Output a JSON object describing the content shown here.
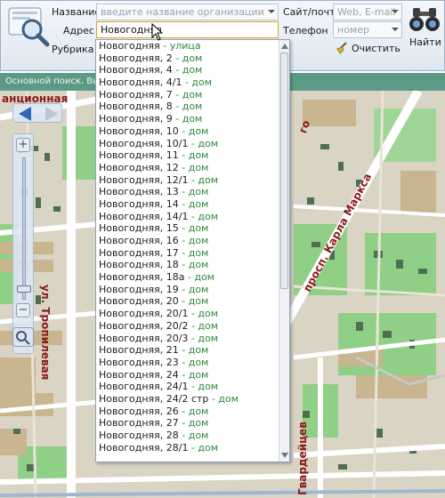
{
  "toolbar": {
    "name_label": "Название",
    "name_placeholder": "введите название организации",
    "address_label": "Адрес",
    "address_value": "Новогодняя",
    "rubric_label": "Рубрика",
    "site_label": "Сайт/почта",
    "site_placeholder": "Web, E-mail",
    "phone_label": "Телефон",
    "phone_placeholder": "номер",
    "clear_label": "Очистить",
    "find_label": "Найти"
  },
  "status_strip": "Основной поиск. Вы",
  "map": {
    "street_labels": [
      "анционная",
      "ул. Тропилевая",
      "просп. Карла Маркса",
      "Гвардейцев",
      "го"
    ]
  },
  "suggestions": [
    {
      "name": "Новогодняя",
      "kind": " - улица"
    },
    {
      "name": "Новогодняя, 2",
      "kind": " - дом"
    },
    {
      "name": "Новогодняя, 4",
      "kind": " - дом"
    },
    {
      "name": "Новогодняя, 4/1",
      "kind": " - дом"
    },
    {
      "name": "Новогодняя, 7",
      "kind": " - дом"
    },
    {
      "name": "Новогодняя, 8",
      "kind": " - дом"
    },
    {
      "name": "Новогодняя, 9",
      "kind": " - дом"
    },
    {
      "name": "Новогодняя, 10",
      "kind": " - дом"
    },
    {
      "name": "Новогодняя, 10/1",
      "kind": " - дом"
    },
    {
      "name": "Новогодняя, 11",
      "kind": " - дом"
    },
    {
      "name": "Новогодняя, 12",
      "kind": " - дом"
    },
    {
      "name": "Новогодняя, 12/1",
      "kind": " - дом"
    },
    {
      "name": "Новогодняя, 13",
      "kind": " - дом"
    },
    {
      "name": "Новогодняя, 14",
      "kind": " - дом"
    },
    {
      "name": "Новогодняя, 14/1",
      "kind": " - дом"
    },
    {
      "name": "Новогодняя, 15",
      "kind": " - дом"
    },
    {
      "name": "Новогодняя, 16",
      "kind": " - дом"
    },
    {
      "name": "Новогодняя, 17",
      "kind": " - дом"
    },
    {
      "name": "Новогодняя, 18",
      "kind": " - дом"
    },
    {
      "name": "Новогодняя, 18а",
      "kind": " - дом"
    },
    {
      "name": "Новогодняя, 19",
      "kind": " - дом"
    },
    {
      "name": "Новогодняя, 20",
      "kind": " - дом"
    },
    {
      "name": "Новогодняя, 20/1",
      "kind": " - дом"
    },
    {
      "name": "Новогодняя, 20/2",
      "kind": " - дом"
    },
    {
      "name": "Новогодняя, 20/3",
      "kind": " - дом"
    },
    {
      "name": "Новогодняя, 21",
      "kind": " - дом"
    },
    {
      "name": "Новогодняя, 23",
      "kind": " - дом"
    },
    {
      "name": "Новогодняя, 24",
      "kind": " - дом"
    },
    {
      "name": "Новогодняя, 24/1",
      "kind": " - дом"
    },
    {
      "name": "Новогодняя, 24/2 стр",
      "kind": " - дом"
    },
    {
      "name": "Новогодняя, 26",
      "kind": " - дом"
    },
    {
      "name": "Новогодняя, 27",
      "kind": " - дом"
    },
    {
      "name": "Новогодняя, 28",
      "kind": " - дом"
    },
    {
      "name": "Новогодняя, 28/1",
      "kind": " - дом"
    }
  ],
  "colors": {
    "toolbar_bg": "#dfe8f1",
    "status_bg": "#5d9a86",
    "map_land": "#d9d4c4",
    "map_park": "#8fcf86",
    "map_block": "#c9b58f",
    "street_label": "#8b1a1a",
    "suggest_kind": "#2f8a3c",
    "active_border": "#e0a020"
  },
  "icons": [
    "search-magnifier-icon",
    "binoculars-icon",
    "broom-icon",
    "arrow-left-icon",
    "arrow-right-icon",
    "zoom-in-icon",
    "zoom-out-icon"
  ]
}
